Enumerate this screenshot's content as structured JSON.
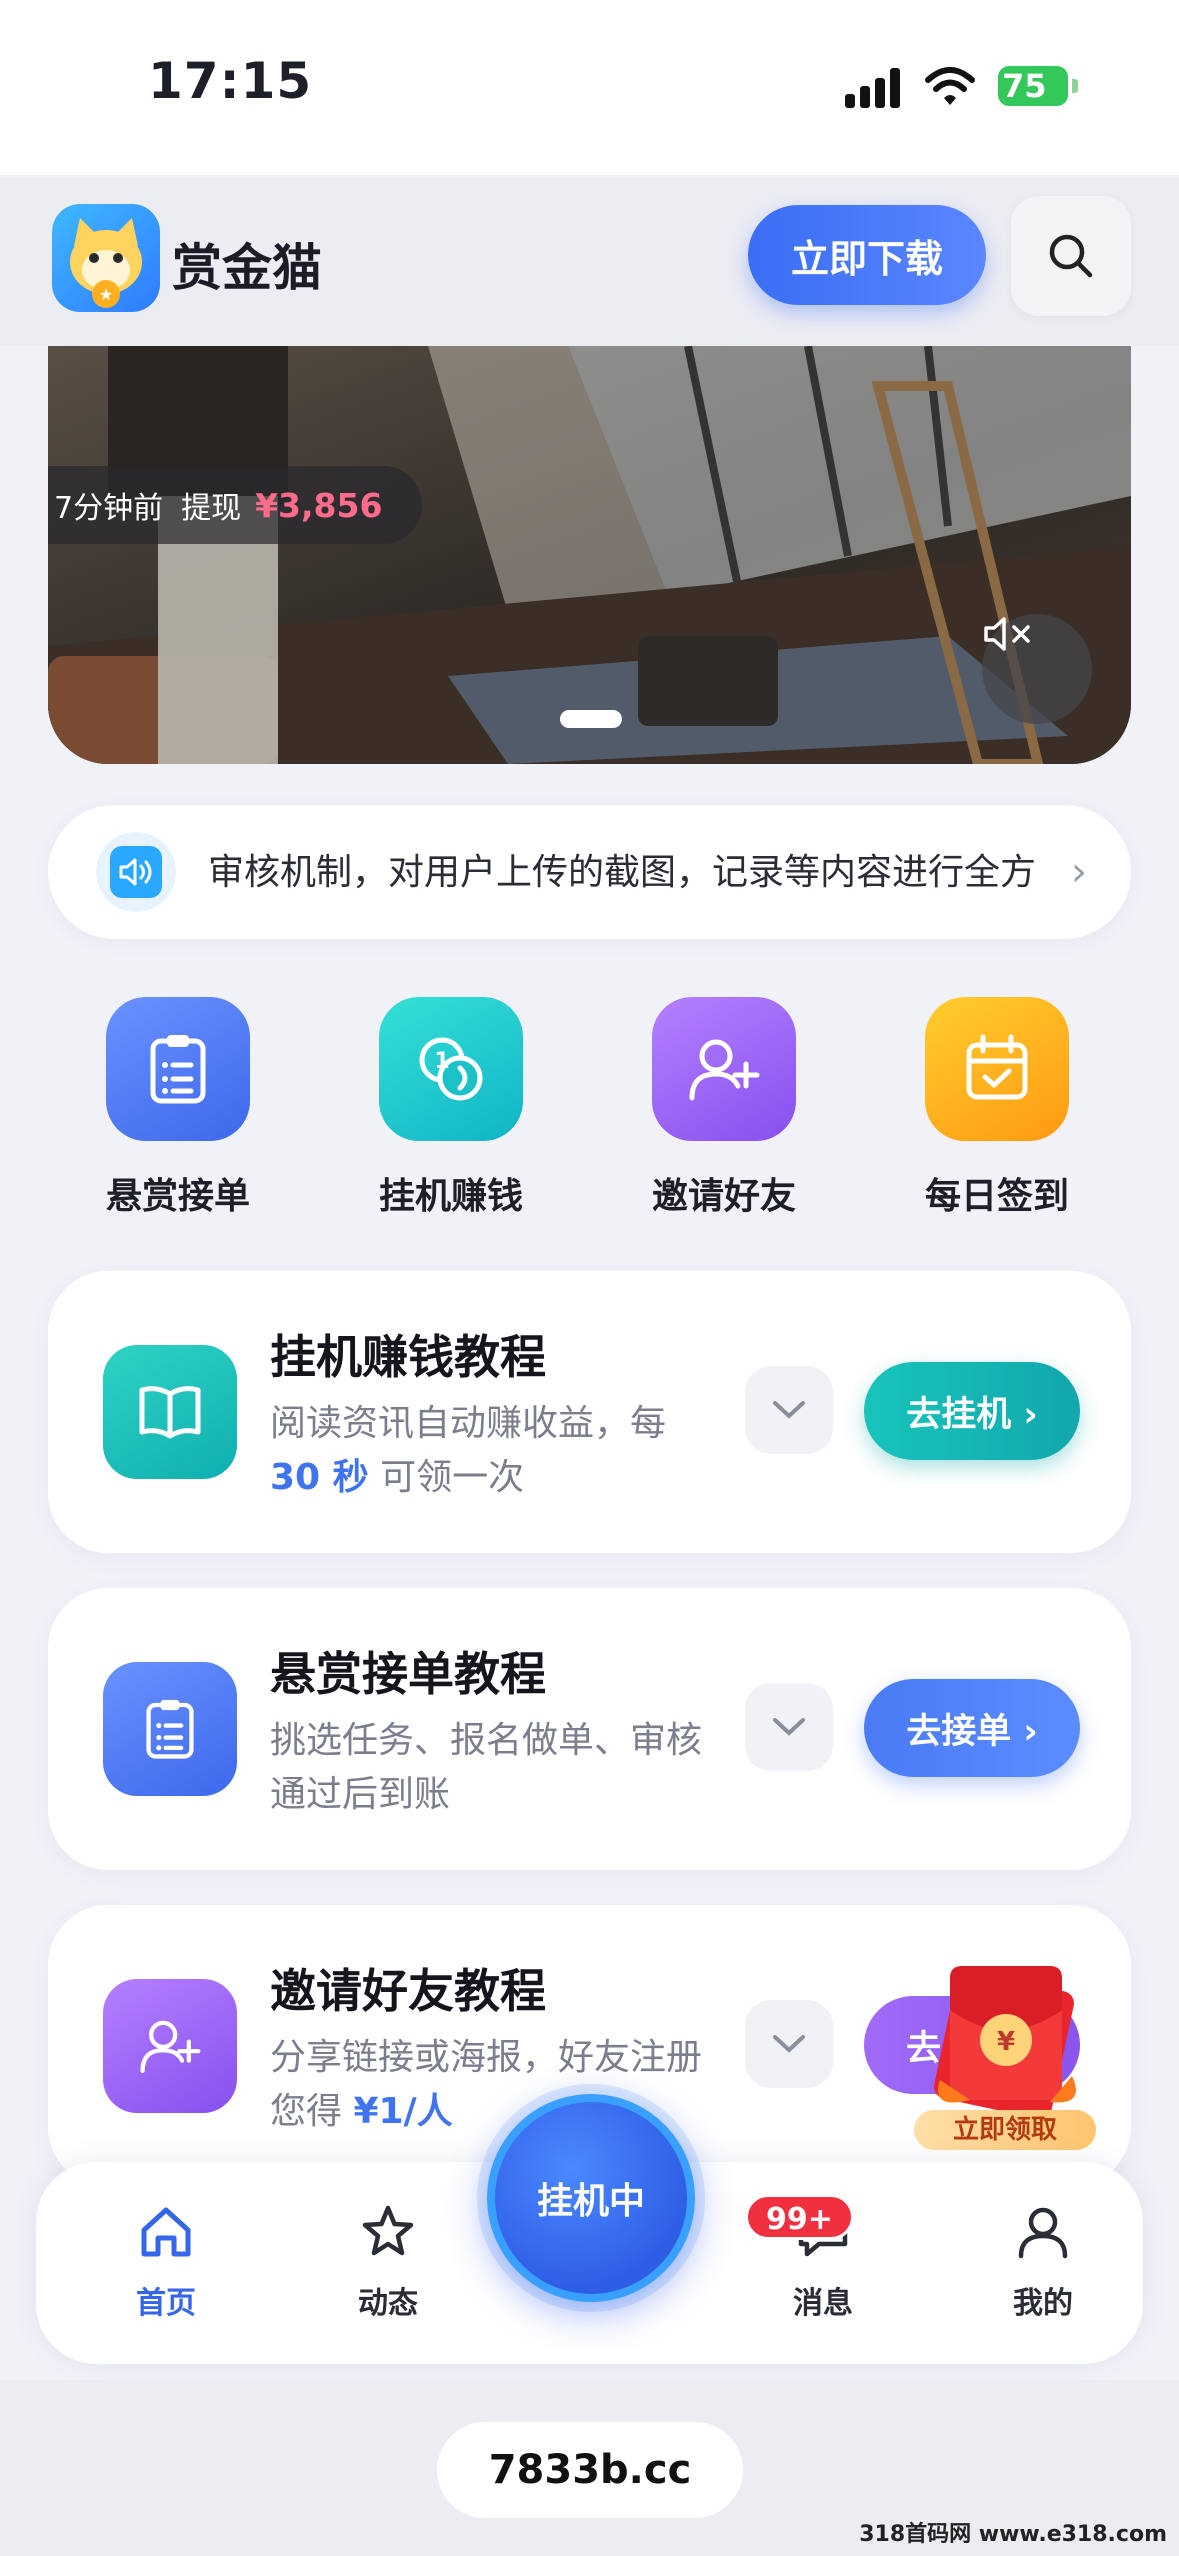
{
  "status_bar": {
    "time": "17:15",
    "battery": "75"
  },
  "header": {
    "app_name": "赏金猫",
    "download_label": "立即下载",
    "search_icon": "search-icon"
  },
  "banner": {
    "toast": {
      "time_ago": "7分钟前",
      "action": "提现",
      "amount": "¥3,856"
    },
    "mute_icon": "mute-icon"
  },
  "notice": {
    "text": "审核机制，对用户上传的截图，记录等内容进行全方"
  },
  "quick_actions": [
    {
      "label": "悬赏接单",
      "icon": "clipboard-icon",
      "color": "#4f7cf7"
    },
    {
      "label": "挂机赚钱",
      "icon": "coins-icon",
      "color": "#1ec7c9"
    },
    {
      "label": "邀请好友",
      "icon": "add-user-icon",
      "color": "#9a62f5"
    },
    {
      "label": "每日签到",
      "icon": "calendar-check-icon",
      "color": "#ffae1a"
    }
  ],
  "cards": [
    {
      "title": "挂机赚钱教程",
      "desc_pre": "阅读资讯自动赚收益，每",
      "highlight": "30 秒",
      "desc_post": " 可领一次",
      "button": "去挂机 ›",
      "icon": "book-icon"
    },
    {
      "title": "悬赏接单教程",
      "desc_pre": "挑选任务、报名做单、审核通过后到账",
      "highlight": "",
      "desc_post": "",
      "button": "去接单 ›",
      "icon": "clipboard-icon"
    },
    {
      "title": "邀请好友教程",
      "desc_pre": "分享链接或海报，好友注册您得 ",
      "highlight": "¥1/人",
      "desc_post": "",
      "button": "去",
      "icon": "add-user-icon"
    }
  ],
  "red_packet": {
    "label": "立即领取",
    "symbol": "¥"
  },
  "tabbar": {
    "home": "首页",
    "feed": "动态",
    "center": "挂机中",
    "messages": "消息",
    "messages_badge": "99+",
    "profile": "我的"
  },
  "bottom": {
    "url": "7833b.cc",
    "watermark": "318首码网 www.e318.com"
  }
}
